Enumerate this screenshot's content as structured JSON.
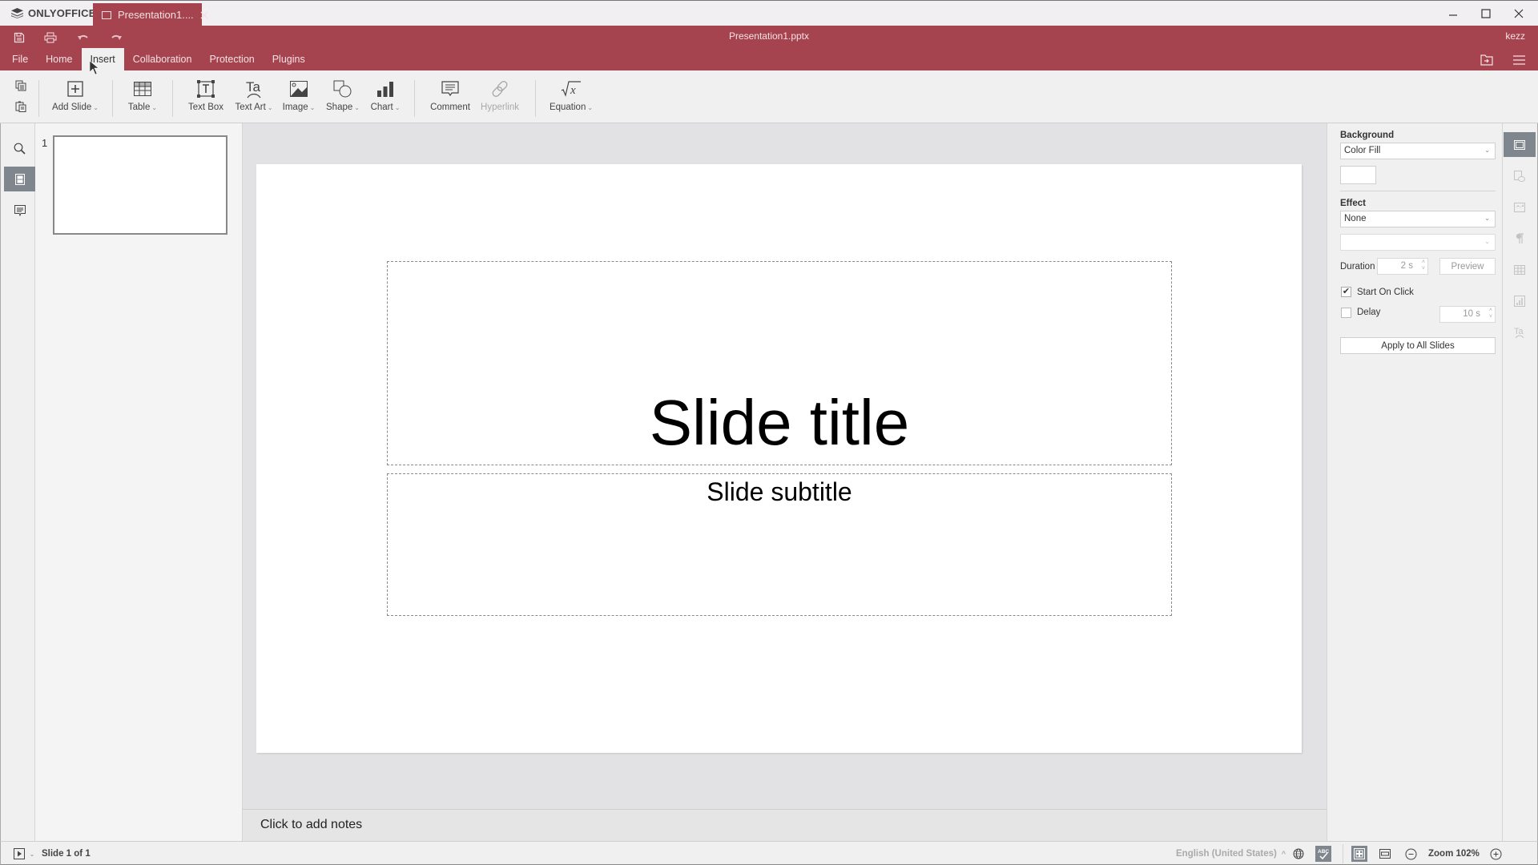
{
  "titlebar": {
    "app_name": "ONLYOFFICE",
    "tab_label": "Presentation1....",
    "window_controls": [
      "minimize-icon",
      "maximize-icon",
      "close-icon"
    ]
  },
  "header": {
    "doc_title": "Presentation1.pptx",
    "user_name": "kezz",
    "quick_access": [
      "save-icon",
      "print-icon",
      "undo-icon",
      "redo-icon"
    ],
    "tabs": [
      {
        "label": "File",
        "active": false
      },
      {
        "label": "Home",
        "active": false
      },
      {
        "label": "Insert",
        "active": true
      },
      {
        "label": "Collaboration",
        "active": false
      },
      {
        "label": "Protection",
        "active": false
      },
      {
        "label": "Plugins",
        "active": false
      }
    ],
    "right_icons": [
      "open-location-icon",
      "menu-icon"
    ]
  },
  "toolbar": {
    "copy_icon": "copy-icon",
    "paste_icon": "paste-icon",
    "buttons": [
      {
        "label": "Add Slide",
        "icon": "add-slide-icon",
        "dropdown": true,
        "disabled": false
      },
      {
        "label": "Table",
        "icon": "table-icon",
        "dropdown": true,
        "disabled": false
      },
      {
        "label": "Text Box",
        "icon": "text-box-icon",
        "dropdown": false,
        "disabled": false
      },
      {
        "label": "Text Art",
        "icon": "text-art-icon",
        "dropdown": true,
        "disabled": false
      },
      {
        "label": "Image",
        "icon": "image-icon",
        "dropdown": true,
        "disabled": false
      },
      {
        "label": "Shape",
        "icon": "shape-icon",
        "dropdown": true,
        "disabled": false
      },
      {
        "label": "Chart",
        "icon": "chart-icon",
        "dropdown": true,
        "disabled": false
      },
      {
        "label": "Comment",
        "icon": "comment-icon",
        "dropdown": false,
        "disabled": false
      },
      {
        "label": "Hyperlink",
        "icon": "hyperlink-icon",
        "dropdown": false,
        "disabled": true
      },
      {
        "label": "Equation",
        "icon": "equation-icon",
        "dropdown": true,
        "disabled": false
      }
    ],
    "caret": "⌄"
  },
  "left_rail": {
    "items": [
      {
        "icon": "search-icon",
        "active": false
      },
      {
        "icon": "slides-icon",
        "active": true
      },
      {
        "icon": "comments-icon",
        "active": false
      }
    ]
  },
  "thumbnails": [
    {
      "number": "1",
      "selected": true
    }
  ],
  "slide": {
    "title": "Slide title",
    "subtitle": "Slide subtitle"
  },
  "notes": {
    "placeholder": "Click to add notes"
  },
  "right_panel": {
    "background_label": "Background",
    "background_fill": "Color Fill",
    "background_color": "#ffffff",
    "effect_label": "Effect",
    "effect_value": "None",
    "effect_type_value": "",
    "duration_label": "Duration",
    "duration_value": "2 s",
    "preview_label": "Preview",
    "start_on_click_label": "Start On Click",
    "start_on_click_checked": true,
    "delay_label": "Delay",
    "delay_checked": false,
    "delay_value": "10 s",
    "apply_all_label": "Apply to All Slides",
    "check_mark": "✔"
  },
  "right_rail": {
    "items": [
      {
        "icon": "slide-settings-icon",
        "active": true
      },
      {
        "icon": "shape-settings-icon",
        "active": false
      },
      {
        "icon": "image-settings-icon",
        "active": false
      },
      {
        "icon": "paragraph-settings-icon",
        "active": false
      },
      {
        "icon": "table-settings-icon",
        "active": false
      },
      {
        "icon": "chart-settings-icon",
        "active": false
      },
      {
        "icon": "text-art-settings-icon",
        "active": false
      }
    ]
  },
  "statusbar": {
    "slide_counter": "Slide 1 of 1",
    "language": "English (United States)",
    "zoom_label": "Zoom 102%",
    "caret_up": "^"
  },
  "colors": {
    "accent": "#a5444f",
    "active_rail": "#7f868e",
    "canvas_bg": "#e2e2e4"
  }
}
